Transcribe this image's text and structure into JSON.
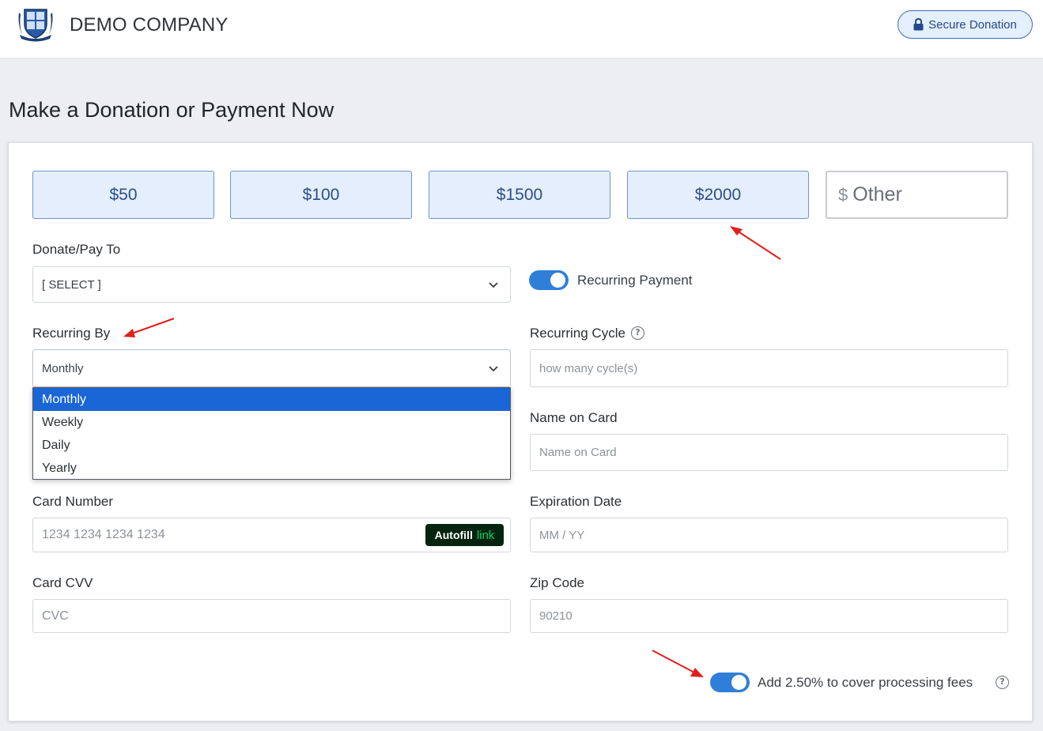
{
  "header": {
    "company_name": "DEMO COMPANY",
    "secure_label": "Secure Donation"
  },
  "page": {
    "title": "Make a Donation or Payment Now"
  },
  "amounts": [
    "$50",
    "$100",
    "$1500",
    "$2000"
  ],
  "other": {
    "symbol": "$",
    "placeholder": "Other"
  },
  "donate_to": {
    "label": "Donate/Pay To",
    "value": "[ SELECT ]"
  },
  "recurring_payment": {
    "label": "Recurring Payment",
    "enabled": true
  },
  "recurring_by": {
    "label": "Recurring By",
    "value": "Monthly",
    "options": [
      "Monthly",
      "Weekly",
      "Daily",
      "Yearly"
    ],
    "selected_index": 0
  },
  "recurring_cycle": {
    "label": "Recurring Cycle",
    "placeholder": "how many cycle(s)",
    "help": "?"
  },
  "name_on_card": {
    "label": "Name on Card",
    "placeholder": "Name on Card"
  },
  "card_number": {
    "label": "Card Number",
    "placeholder": "1234 1234 1234 1234",
    "autofill_label": "Autofill",
    "autofill_link": "link"
  },
  "expiration": {
    "label": "Expiration Date",
    "placeholder": "MM / YY"
  },
  "cvv": {
    "label": "Card CVV",
    "placeholder": "CVC"
  },
  "zip": {
    "label": "Zip Code",
    "placeholder": "90210"
  },
  "fees": {
    "label": "Add 2.50% to cover processing fees",
    "enabled": true,
    "help": "?"
  },
  "colors": {
    "accent": "#2f7fd8",
    "amount_bg": "#e4eefc",
    "selected_option": "#1a66d6",
    "annotation_arrow": "#e0201b"
  }
}
